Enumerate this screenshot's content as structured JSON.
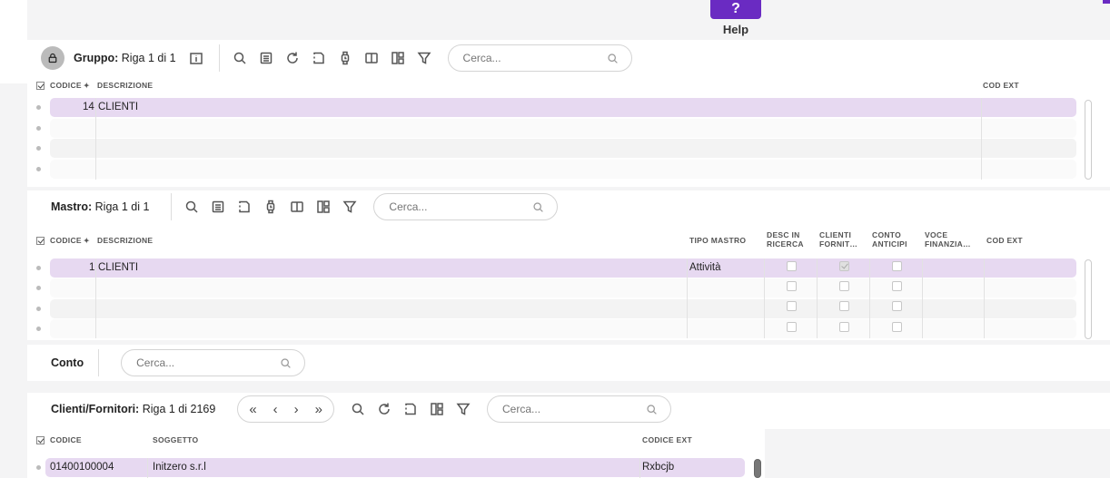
{
  "help": {
    "glyph": "?",
    "label": "Help"
  },
  "icons": [
    "lock-icon",
    "info-icon",
    "search-icon",
    "form-icon",
    "refresh-icon",
    "export-icon",
    "watch-icon",
    "book-icon",
    "layout-icon",
    "filter-icon",
    "first-icon",
    "prev-icon",
    "next-icon",
    "last-icon"
  ],
  "gruppo": {
    "title": "Gruppo:",
    "position": "Riga 1 di 1",
    "search_placeholder": "Cerca...",
    "columns": {
      "codice": "CODICE",
      "descrizione": "DESCRIZIONE",
      "cod_ext": "COD EXT"
    },
    "rows": [
      {
        "codice": "14",
        "descrizione": "CLIENTI",
        "cod_ext": ""
      }
    ]
  },
  "mastro": {
    "title": "Mastro:",
    "position": "Riga 1 di 1",
    "search_placeholder": "Cerca...",
    "columns": {
      "codice": "CODICE",
      "descrizione": "DESCRIZIONE",
      "tipo_mastro": "TIPO MASTRO",
      "desc_in_ricerca_1": "DESC IN",
      "desc_in_ricerca_2": "RICERCA",
      "clienti_fornit_1": "CLIENTI",
      "clienti_fornit_2": "FORNIT…",
      "conto_anticipi_1": "CONTO",
      "conto_anticipi_2": "ANTICIPI",
      "voce_finanzia_1": "VOCE",
      "voce_finanzia_2": "FINANZIA…",
      "cod_ext": "COD EXT"
    },
    "rows": [
      {
        "codice": "1",
        "descrizione": "CLIENTI",
        "tipo_mastro": "Attività",
        "desc_in_ricerca": false,
        "clienti_fornitori": true,
        "conto_anticipi": false
      }
    ]
  },
  "conto": {
    "title": "Conto",
    "search_placeholder": "Cerca..."
  },
  "clienti": {
    "title": "Clienti/Fornitori:",
    "position": "Riga 1 di 2169",
    "search_placeholder": "Cerca...",
    "nav": {
      "first": "«",
      "prev": "‹",
      "next": "›",
      "last": "»"
    },
    "columns": {
      "codice": "CODICE",
      "soggetto": "SOGGETTO",
      "codice_ext": "CODICE EXT"
    },
    "rows": [
      {
        "codice": "01400100004",
        "soggetto": "Initzero s.r.l",
        "codice_ext": "Rxbcjb"
      }
    ]
  }
}
